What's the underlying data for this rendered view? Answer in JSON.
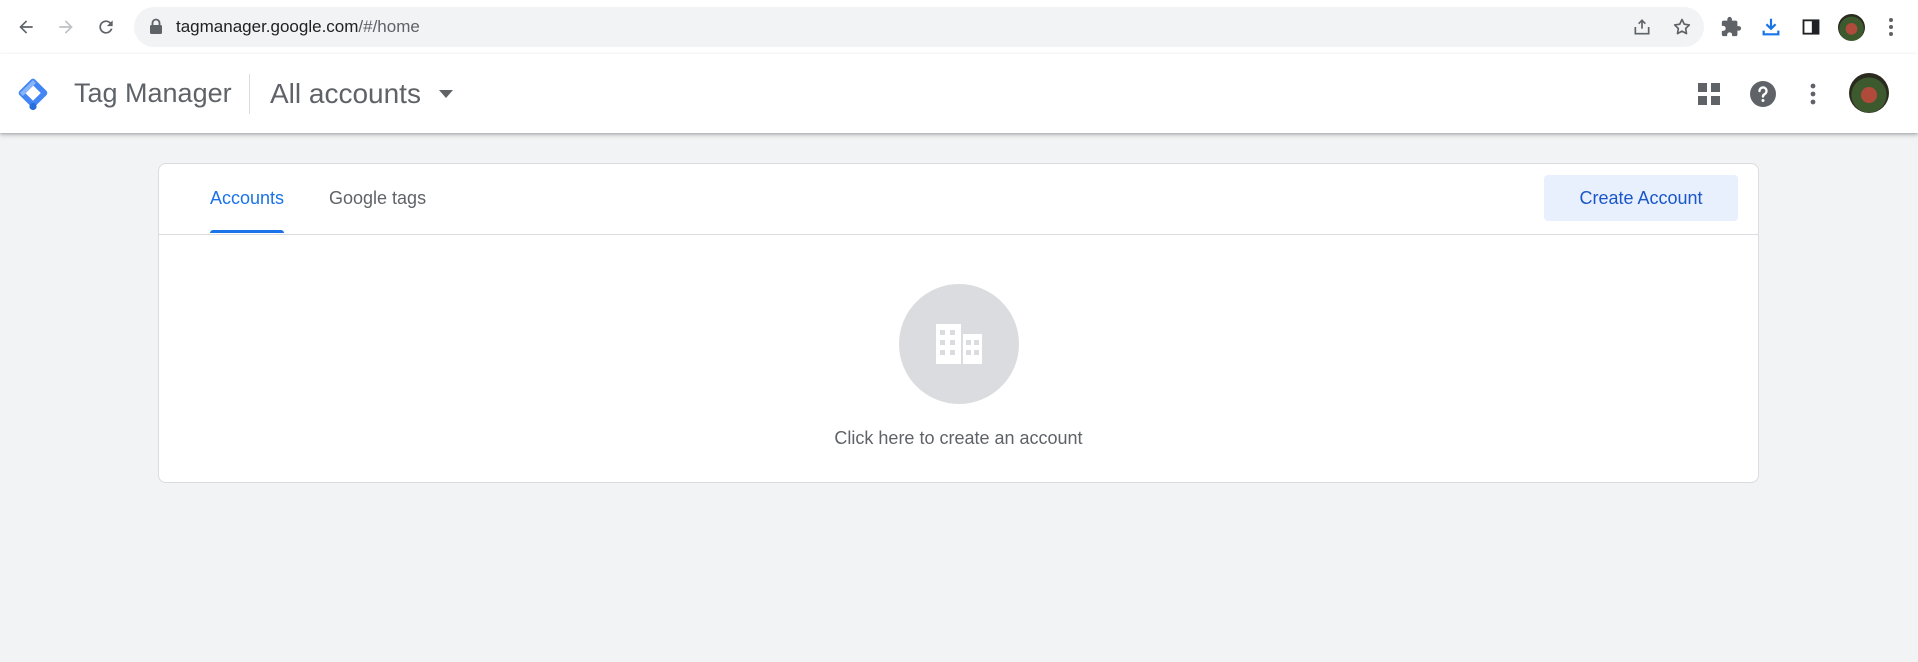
{
  "browser": {
    "url_host": "tagmanager.google.com",
    "url_path": "/#/home"
  },
  "header": {
    "product_name": "Tag Manager",
    "account_selector": "All accounts"
  },
  "tabs": [
    {
      "label": "Accounts",
      "active": true
    },
    {
      "label": "Google tags",
      "active": false
    }
  ],
  "actions": {
    "create_account": "Create Account"
  },
  "empty_state": {
    "message": "Click here to create an account",
    "icon": "building-icon"
  },
  "colors": {
    "accent": "#1a73e8",
    "page_background": "#f1f3f4",
    "button_background": "#e8f0fe"
  }
}
